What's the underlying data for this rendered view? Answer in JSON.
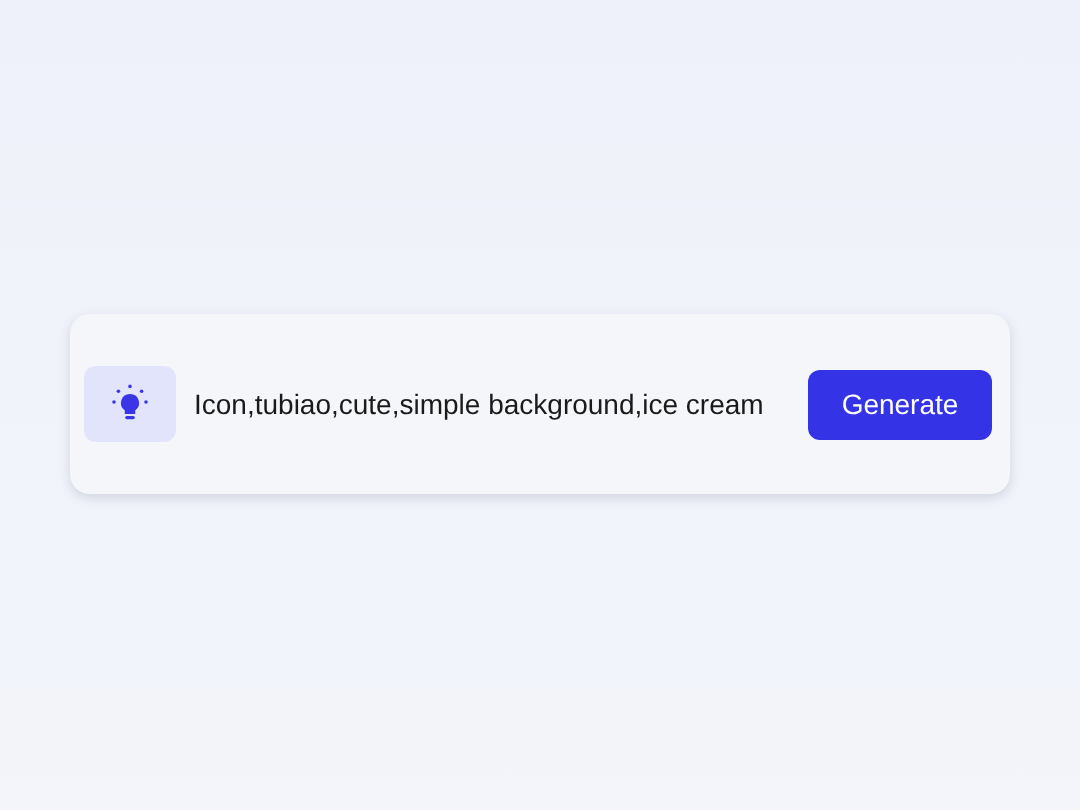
{
  "prompt": {
    "value": "Icon,tubiao,cute,simple background,ice cream"
  },
  "button": {
    "label": "Generate"
  }
}
